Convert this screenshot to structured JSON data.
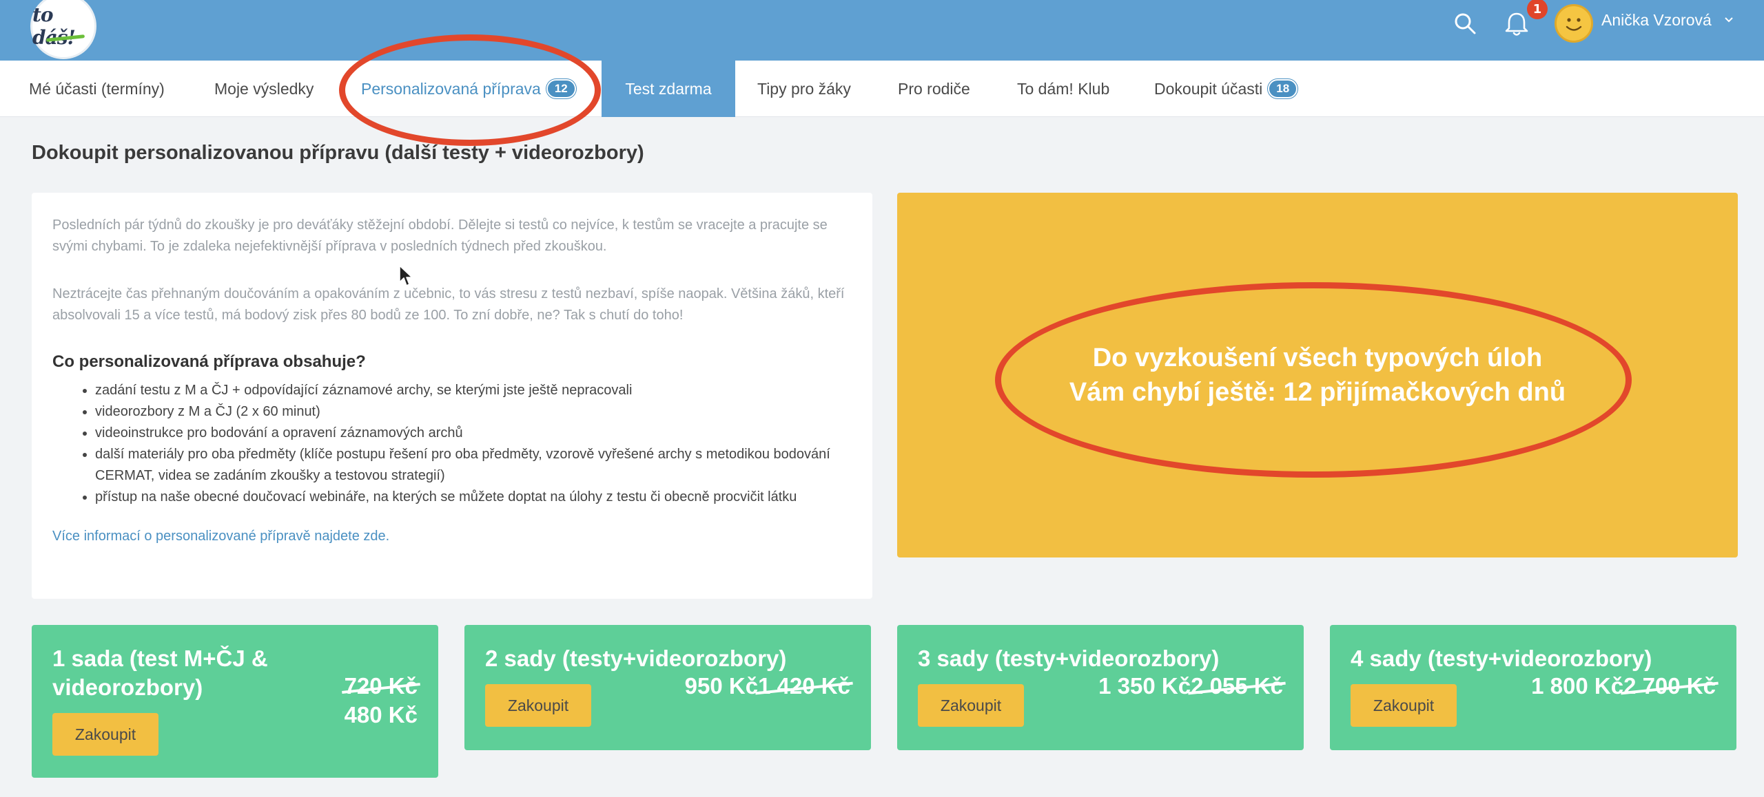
{
  "header": {
    "logo_text": "to dáš!",
    "notifications_count": "1",
    "user_name": "Anička Vzorová"
  },
  "nav": [
    {
      "label": "Mé účasti (termíny)"
    },
    {
      "label": "Moje výsledky"
    },
    {
      "label": "Personalizovaná příprava",
      "badge": "12"
    },
    {
      "label": "Test zdarma"
    },
    {
      "label": "Tipy pro žáky"
    },
    {
      "label": "Pro rodiče"
    },
    {
      "label": "To dám! Klub"
    },
    {
      "label": "Dokoupit účasti",
      "badge": "18"
    }
  ],
  "page_title": "Dokoupit personalizovanou přípravu (další testy + videorozbory)",
  "info": {
    "p1": "Posledních pár týdnů do zkoušky je pro deváťáky stěžejní období. Dělejte si testů co nejvíce, k testům se vracejte a pracujte se svými chybami. To je zdaleka nejefektivnější příprava v posledních týdnech před zkouškou.",
    "p2": "Neztrácejte čas přehnaným doučováním a opakováním z učebnic, to vás stresu z testů nezbaví, spíše naopak. Většina žáků, kteří absolvovali 15 a více testů, má bodový zisk přes 80 bodů ze 100. To zní dobře, ne? Tak s chutí do toho!",
    "heading": "Co personalizovaná příprava obsahuje?",
    "items": [
      "zadání testu z M a ČJ + odpovídající záznamové archy, se kterými jste ještě nepracovali",
      "videorozbory z M a ČJ (2 x 60 minut)",
      "videoinstrukce pro bodování a opravení záznamových archů",
      "další materiály pro oba předměty (klíče postupu řešení pro oba předměty, vzorově vyřešené archy s metodikou bodování CERMAT, videa se zadáním zkoušky a testovou strategií)",
      "přístup na naše obecné doučovací webináře, na kterých se můžete doptat na úlohy z testu či obecně procvičit látku"
    ],
    "more_link": "Více informací o personalizované přípravě najdete zde."
  },
  "promo": {
    "line1": "Do vyzkoušení všech typových úloh",
    "line2": "Vám chybí ještě: 12 přijímačkových dnů"
  },
  "cards": [
    {
      "title": "1 sada (test M+ČJ & videorozbory)",
      "old_price": "720 Kč",
      "price": "480 Kč",
      "button": "Zakoupit"
    },
    {
      "title": "2 sady (testy+videorozbory)",
      "old_price": "1 420 Kč",
      "price": "950 Kč",
      "button": "Zakoupit"
    },
    {
      "title": "3 sady (testy+videorozbory)",
      "old_price": "2 055 Kč",
      "price": "1 350 Kč",
      "button": "Zakoupit"
    },
    {
      "title": "4 sady (testy+videorozbory)",
      "old_price": "2 700 Kč",
      "price": "1 800 Kč",
      "button": "Zakoupit"
    }
  ],
  "colors": {
    "header_blue": "#5fa0d2",
    "card_green": "#5ecf98",
    "promo_yellow": "#f2bf42",
    "annotation_red": "#e2472b"
  }
}
